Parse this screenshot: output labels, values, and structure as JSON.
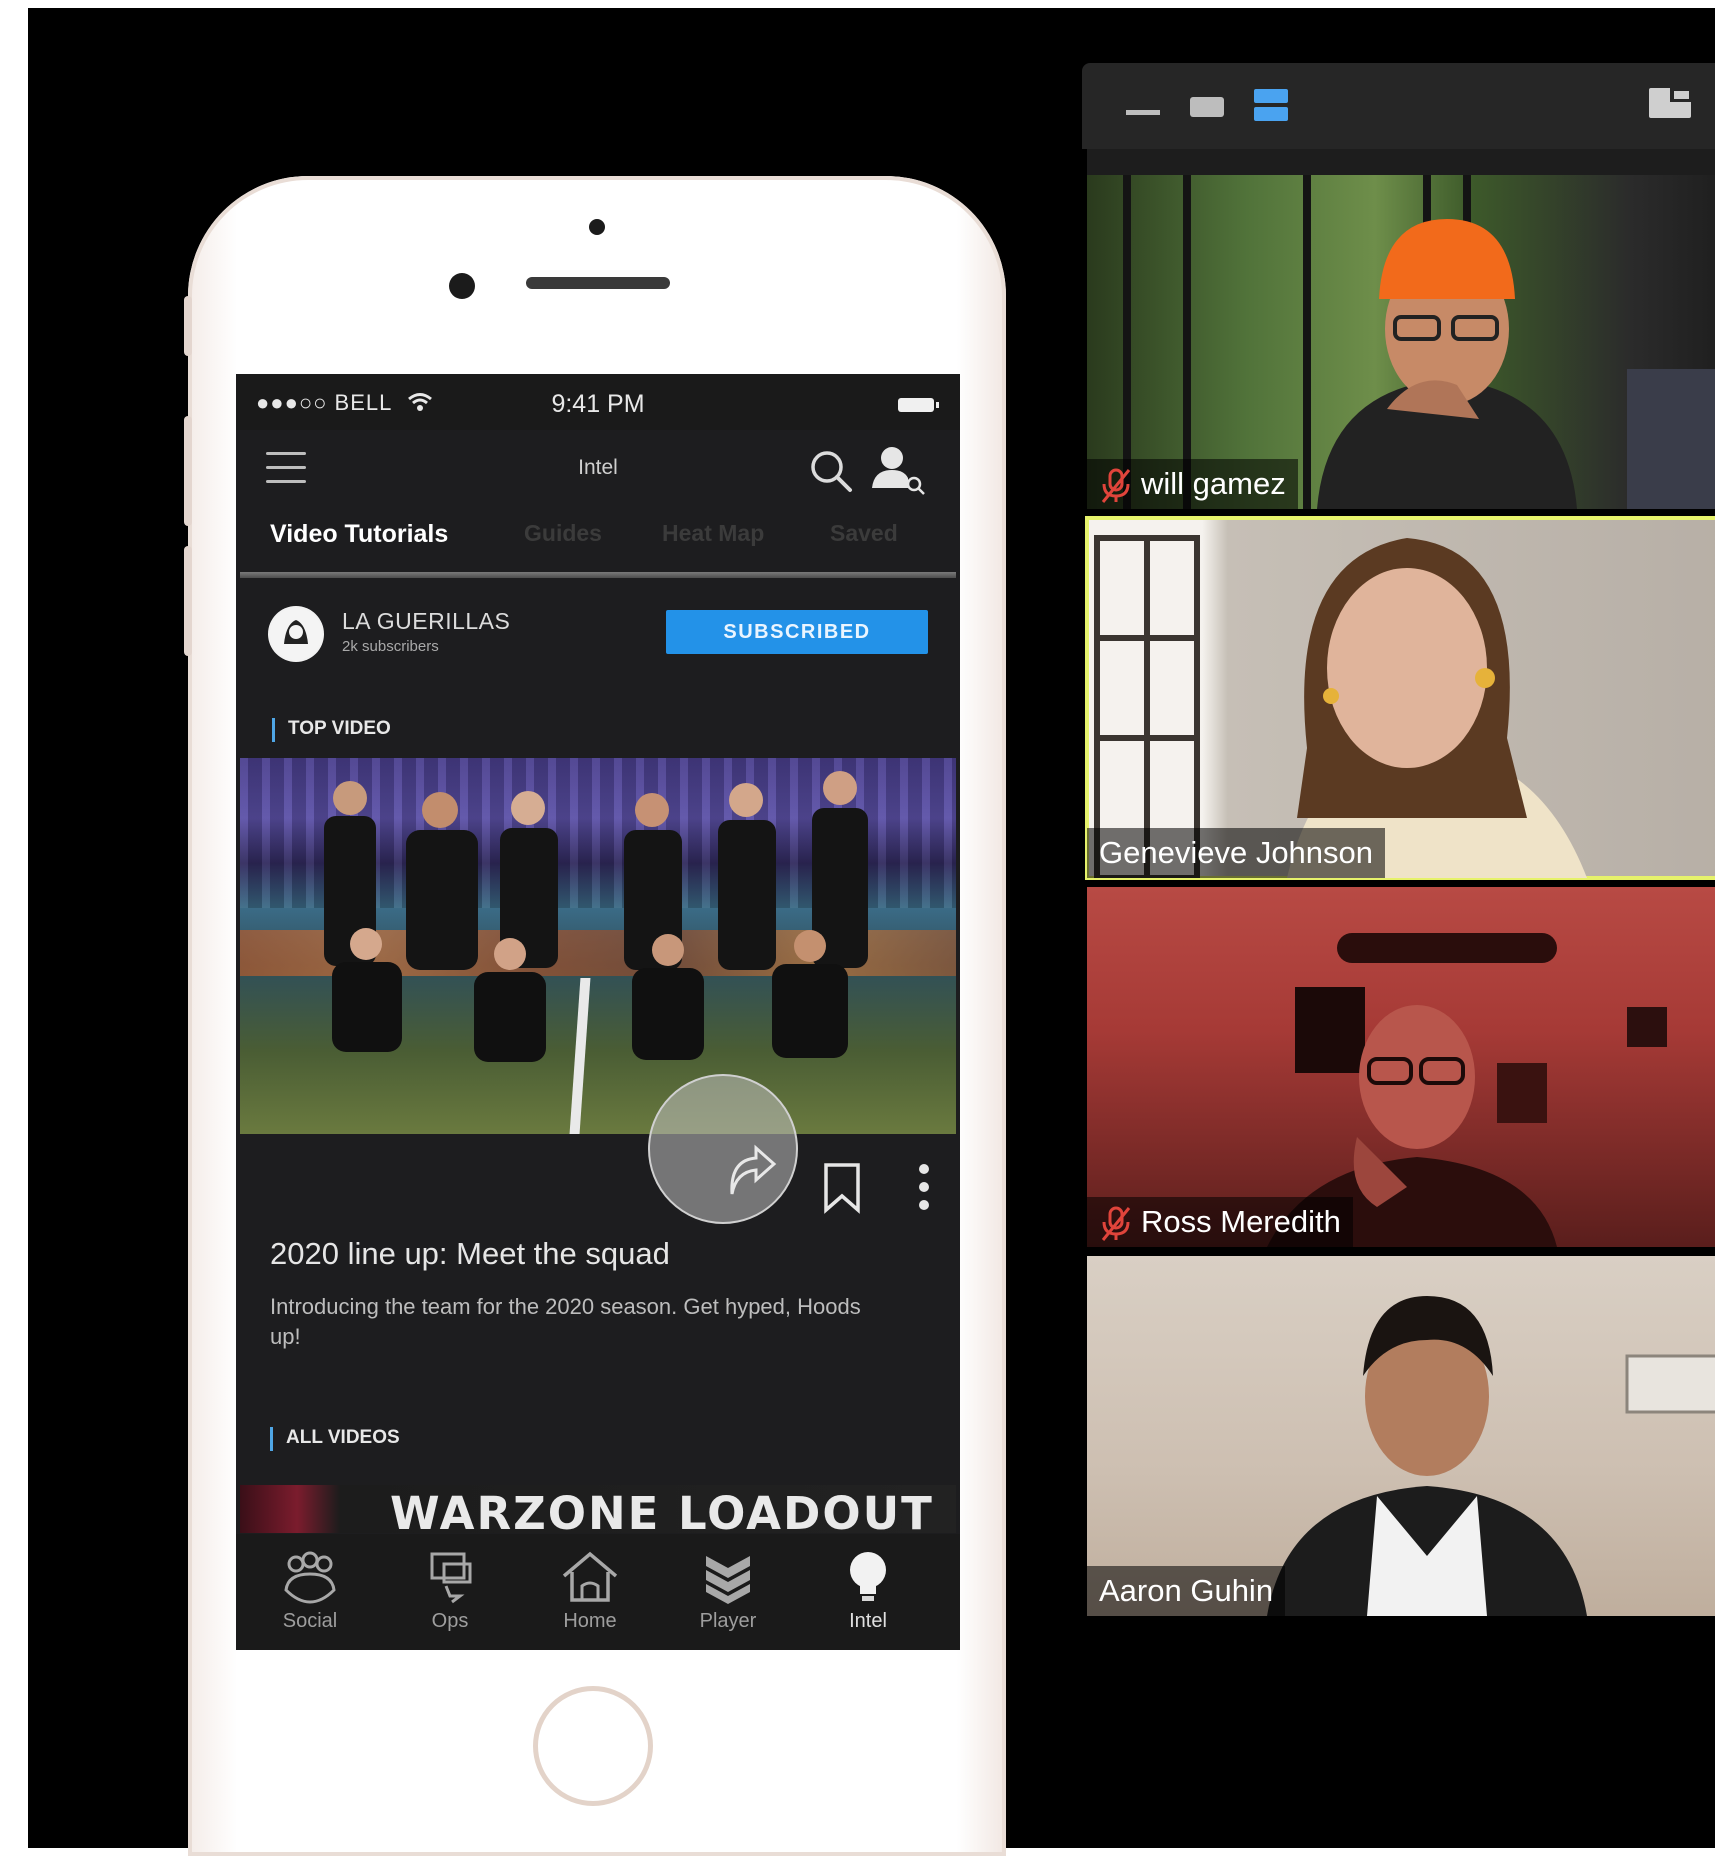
{
  "phone": {
    "status_bar": {
      "carrier": "●●●○○ BELL",
      "time": "9:41 PM"
    },
    "nav": {
      "title": "Intel"
    },
    "tabs": [
      {
        "label": "Video Tutorials"
      },
      {
        "label": "Guides"
      },
      {
        "label": "Heat Map"
      },
      {
        "label": "Saved"
      }
    ],
    "channel": {
      "name": "LA GUERILLAS",
      "subscribers": "2k subscribers",
      "subscribe_label": "SUBSCRIBED"
    },
    "top_video": {
      "section_label": "TOP VIDEO",
      "title": "2020 line up: Meet the squad",
      "description": "Introducing the team for the 2020 season. Get hyped, Hoods up!"
    },
    "all_videos": {
      "section_label": "ALL VIDEOS",
      "next_title": "WARZONE LOADOUT"
    },
    "tabbar": [
      {
        "label": "Social",
        "icon": "social-icon"
      },
      {
        "label": "Ops",
        "icon": "ops-icon"
      },
      {
        "label": "Home",
        "icon": "home-icon"
      },
      {
        "label": "Player",
        "icon": "player-rank-icon"
      },
      {
        "label": "Intel",
        "icon": "lightbulb-icon"
      }
    ],
    "active_tab": "Intel"
  },
  "call": {
    "participants": [
      {
        "name": "will gamez",
        "muted": true
      },
      {
        "name": "Genevieve Johnson",
        "muted": false,
        "active_speaker": true
      },
      {
        "name": "Ross Meredith",
        "muted": true
      },
      {
        "name": "Aaron Guhin",
        "muted": false
      }
    ],
    "colors": {
      "active_speaker_border": "#e6f26b",
      "mute_icon": "#e0443b",
      "layout_active": "#4aa3f0"
    }
  }
}
